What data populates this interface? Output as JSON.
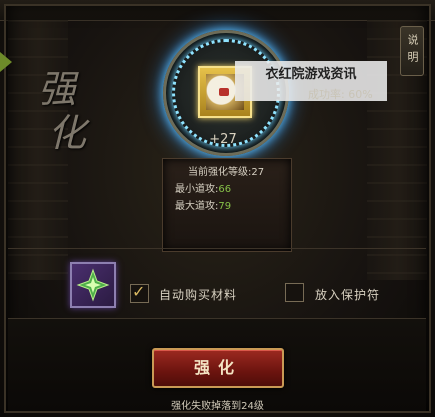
{
  "panel": {
    "title_chars": [
      "强",
      "化"
    ],
    "help_label": "说明"
  },
  "orb": {
    "level_label": "+27"
  },
  "watermark": {
    "text": "衣红院游戏资讯"
  },
  "success": {
    "text": "成功率: 60%"
  },
  "stats": {
    "current_level_label": "当前强化等级:",
    "current_level_value": "27",
    "min_attack_label": "最小道攻:",
    "min_attack_value": "66",
    "max_attack_label": "最大道攻:",
    "max_attack_value": "79"
  },
  "options": {
    "auto_buy_label": "自动购买材料",
    "auto_buy_checked": true,
    "protect_label": "放入保护符",
    "protect_checked": false
  },
  "actions": {
    "enhance_label": "强化"
  },
  "footer": {
    "fail_note": "强化失败掉落到24级"
  },
  "colors": {
    "stat_value": "#86c048",
    "orb_glow": "#5fc3ff",
    "button_red": "#9c2a20"
  }
}
